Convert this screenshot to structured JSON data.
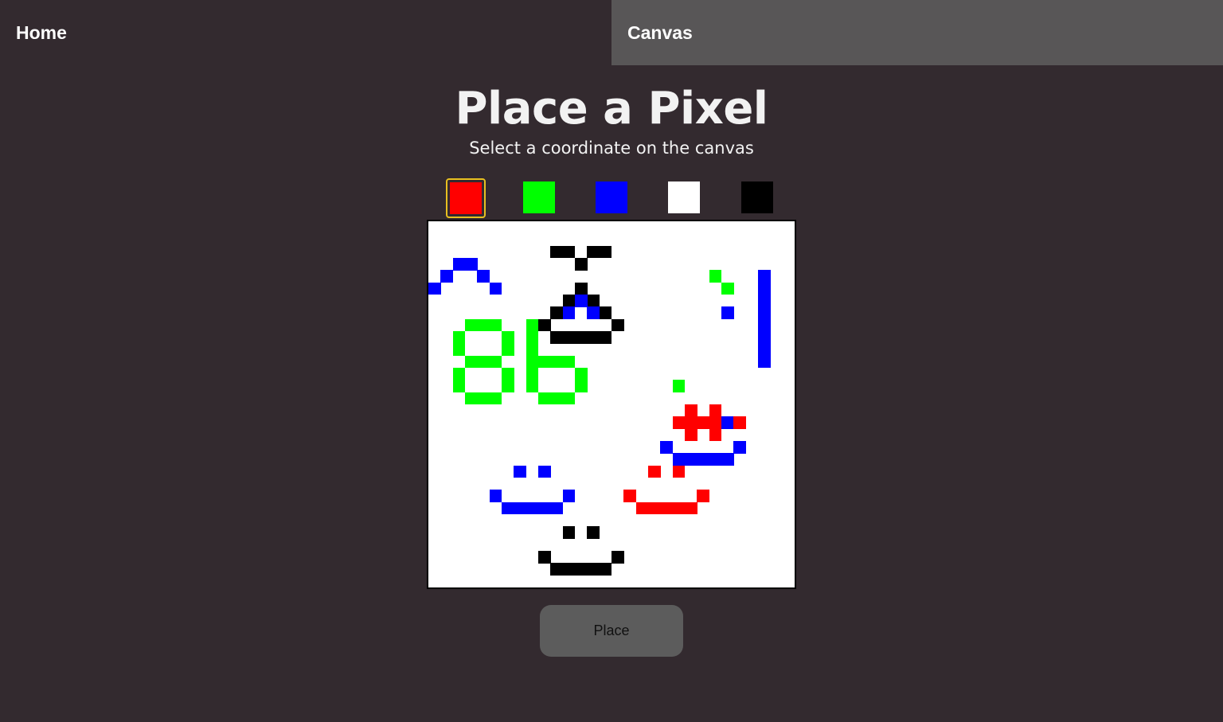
{
  "nav": {
    "home_label": "Home",
    "canvas_label": "Canvas"
  },
  "header": {
    "title": "Place a Pixel",
    "subtitle": "Select a coordinate on the canvas"
  },
  "palette": {
    "selected": "red",
    "colors": [
      {
        "name": "red",
        "hex": "#ff0000"
      },
      {
        "name": "green",
        "hex": "#00ff00"
      },
      {
        "name": "blue",
        "hex": "#0000ff"
      },
      {
        "name": "white",
        "hex": "#ffffff"
      },
      {
        "name": "black",
        "hex": "#000000"
      }
    ]
  },
  "canvas": {
    "grid_size": 30,
    "background": "#ffffff",
    "pixels": {
      "black": [
        [
          10,
          2
        ],
        [
          11,
          2
        ],
        [
          13,
          2
        ],
        [
          14,
          2
        ],
        [
          12,
          3
        ],
        [
          12,
          5
        ],
        [
          11,
          6
        ],
        [
          13,
          6
        ],
        [
          10,
          7
        ],
        [
          14,
          7
        ],
        [
          9,
          8
        ],
        [
          15,
          8
        ],
        [
          10,
          9
        ],
        [
          11,
          9
        ],
        [
          12,
          9
        ],
        [
          13,
          9
        ],
        [
          14,
          9
        ],
        [
          9,
          27
        ],
        [
          10,
          28
        ],
        [
          11,
          28
        ],
        [
          12,
          28
        ],
        [
          13,
          28
        ],
        [
          14,
          28
        ],
        [
          15,
          27
        ],
        [
          11,
          25
        ],
        [
          13,
          25
        ]
      ],
      "blue": [
        [
          0,
          5
        ],
        [
          1,
          4
        ],
        [
          2,
          3
        ],
        [
          3,
          3
        ],
        [
          4,
          4
        ],
        [
          5,
          5
        ],
        [
          12,
          6
        ],
        [
          11,
          7
        ],
        [
          13,
          7
        ],
        [
          24,
          7
        ],
        [
          27,
          4
        ],
        [
          27,
          5
        ],
        [
          27,
          6
        ],
        [
          27,
          7
        ],
        [
          27,
          8
        ],
        [
          27,
          9
        ],
        [
          27,
          10
        ],
        [
          27,
          11
        ],
        [
          20,
          16
        ],
        [
          24,
          16
        ],
        [
          19,
          18
        ],
        [
          20,
          19
        ],
        [
          21,
          19
        ],
        [
          22,
          19
        ],
        [
          23,
          19
        ],
        [
          24,
          19
        ],
        [
          25,
          18
        ],
        [
          7,
          20
        ],
        [
          9,
          20
        ],
        [
          5,
          22
        ],
        [
          6,
          23
        ],
        [
          7,
          23
        ],
        [
          8,
          23
        ],
        [
          9,
          23
        ],
        [
          10,
          23
        ],
        [
          11,
          22
        ]
      ],
      "green": [
        [
          23,
          4
        ],
        [
          24,
          5
        ],
        [
          20,
          13
        ],
        [
          3,
          8
        ],
        [
          4,
          8
        ],
        [
          5,
          8
        ],
        [
          2,
          9
        ],
        [
          2,
          10
        ],
        [
          6,
          9
        ],
        [
          6,
          10
        ],
        [
          3,
          11
        ],
        [
          4,
          11
        ],
        [
          5,
          11
        ],
        [
          2,
          12
        ],
        [
          2,
          13
        ],
        [
          6,
          12
        ],
        [
          6,
          13
        ],
        [
          3,
          14
        ],
        [
          4,
          14
        ],
        [
          5,
          14
        ],
        [
          8,
          8
        ],
        [
          8,
          9
        ],
        [
          8,
          10
        ],
        [
          8,
          11
        ],
        [
          8,
          12
        ],
        [
          8,
          13
        ],
        [
          9,
          11
        ],
        [
          10,
          11
        ],
        [
          11,
          11
        ],
        [
          12,
          12
        ],
        [
          12,
          13
        ],
        [
          9,
          14
        ],
        [
          10,
          14
        ],
        [
          11,
          14
        ]
      ],
      "red": [
        [
          21,
          15
        ],
        [
          23,
          15
        ],
        [
          20,
          16
        ],
        [
          21,
          16
        ],
        [
          22,
          16
        ],
        [
          23,
          16
        ],
        [
          25,
          16
        ],
        [
          21,
          17
        ],
        [
          23,
          17
        ],
        [
          18,
          20
        ],
        [
          20,
          20
        ],
        [
          16,
          22
        ],
        [
          17,
          23
        ],
        [
          18,
          23
        ],
        [
          19,
          23
        ],
        [
          20,
          23
        ],
        [
          21,
          23
        ],
        [
          22,
          22
        ]
      ]
    }
  },
  "actions": {
    "place_label": "Place"
  }
}
